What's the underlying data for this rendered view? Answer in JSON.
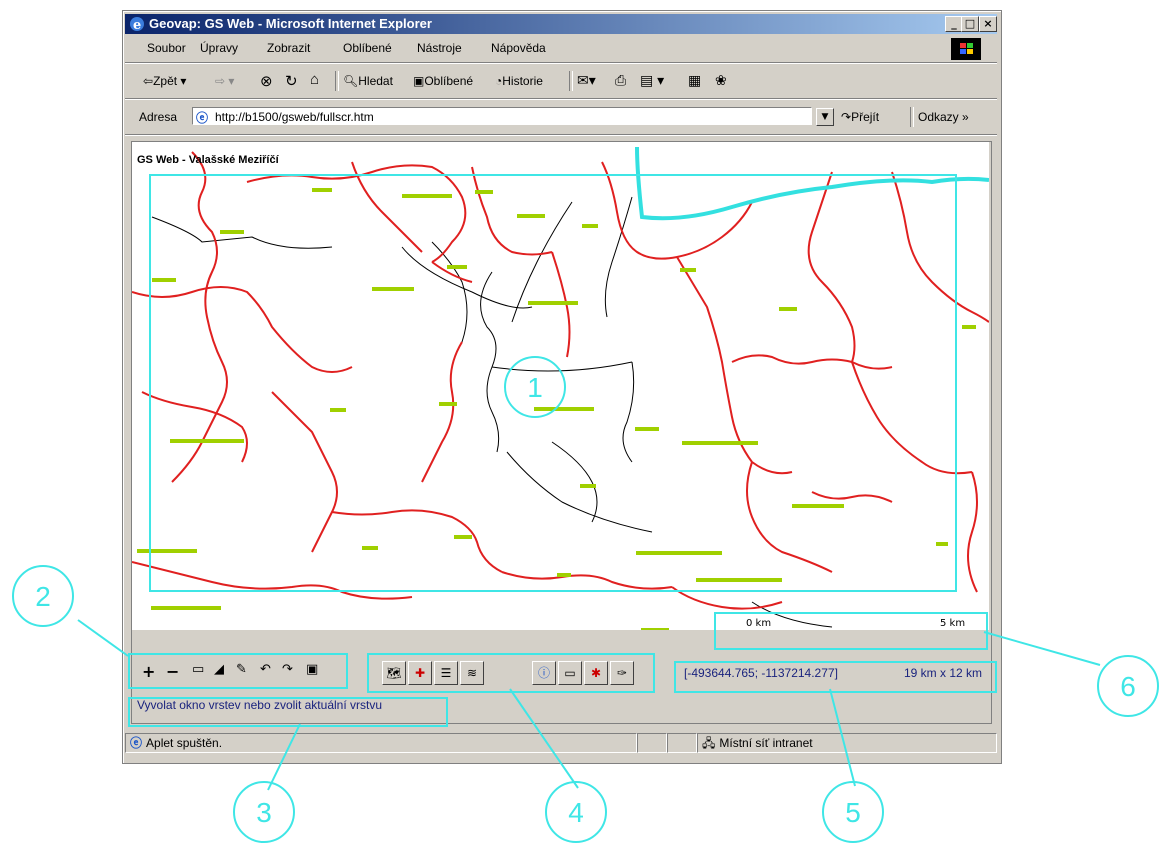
{
  "window": {
    "title": "Geovap: GS Web - Microsoft Internet Explorer",
    "controls": {
      "minimize": "_",
      "maximize": "□",
      "close": "×"
    }
  },
  "menu": [
    "Soubor",
    "Úpravy",
    "Zobrazit",
    "Oblíbené",
    "Nástroje",
    "Nápověda"
  ],
  "toolbar": {
    "back": "Zpět",
    "search": "Hledat",
    "favorites": "Oblíbené",
    "history": "Historie"
  },
  "address": {
    "label": "Adresa",
    "url": "http://b1500/gsweb/fullscr.htm",
    "go": "Přejít",
    "links": "Odkazy"
  },
  "map": {
    "title": "GS Web - Valašské Meziříčí",
    "scale_start": "0 km",
    "scale_end": "5 km",
    "coordinates": "[-493644.765; -1137214.277]",
    "extent": "19 km x 12 km",
    "status_message": "Vyvolat okno vrstev nebo zvolit aktuální vrstvu",
    "colors": {
      "boundary_major": "#e02020",
      "boundary_minor": "#000000",
      "river": "#33e0e0",
      "label": "#a0d000",
      "annotation": "#3fe6e6"
    }
  },
  "nav_tools": [
    "plus-icon",
    "minus-icon",
    "window-icon",
    "mountain-icon",
    "pencil-icon",
    "undo-icon",
    "redo-icon",
    "overview-icon"
  ],
  "layer_tools": [
    "layers-icon",
    "add-layer-icon",
    "legend-icon",
    "stack-icon",
    "info-icon",
    "measure-icon",
    "select-icon",
    "highlight-icon"
  ],
  "statusbar": {
    "text": "Aplet spuštěn.",
    "zone": "Místní síť intranet"
  },
  "callouts": [
    "1",
    "2",
    "3",
    "4",
    "5",
    "6"
  ]
}
